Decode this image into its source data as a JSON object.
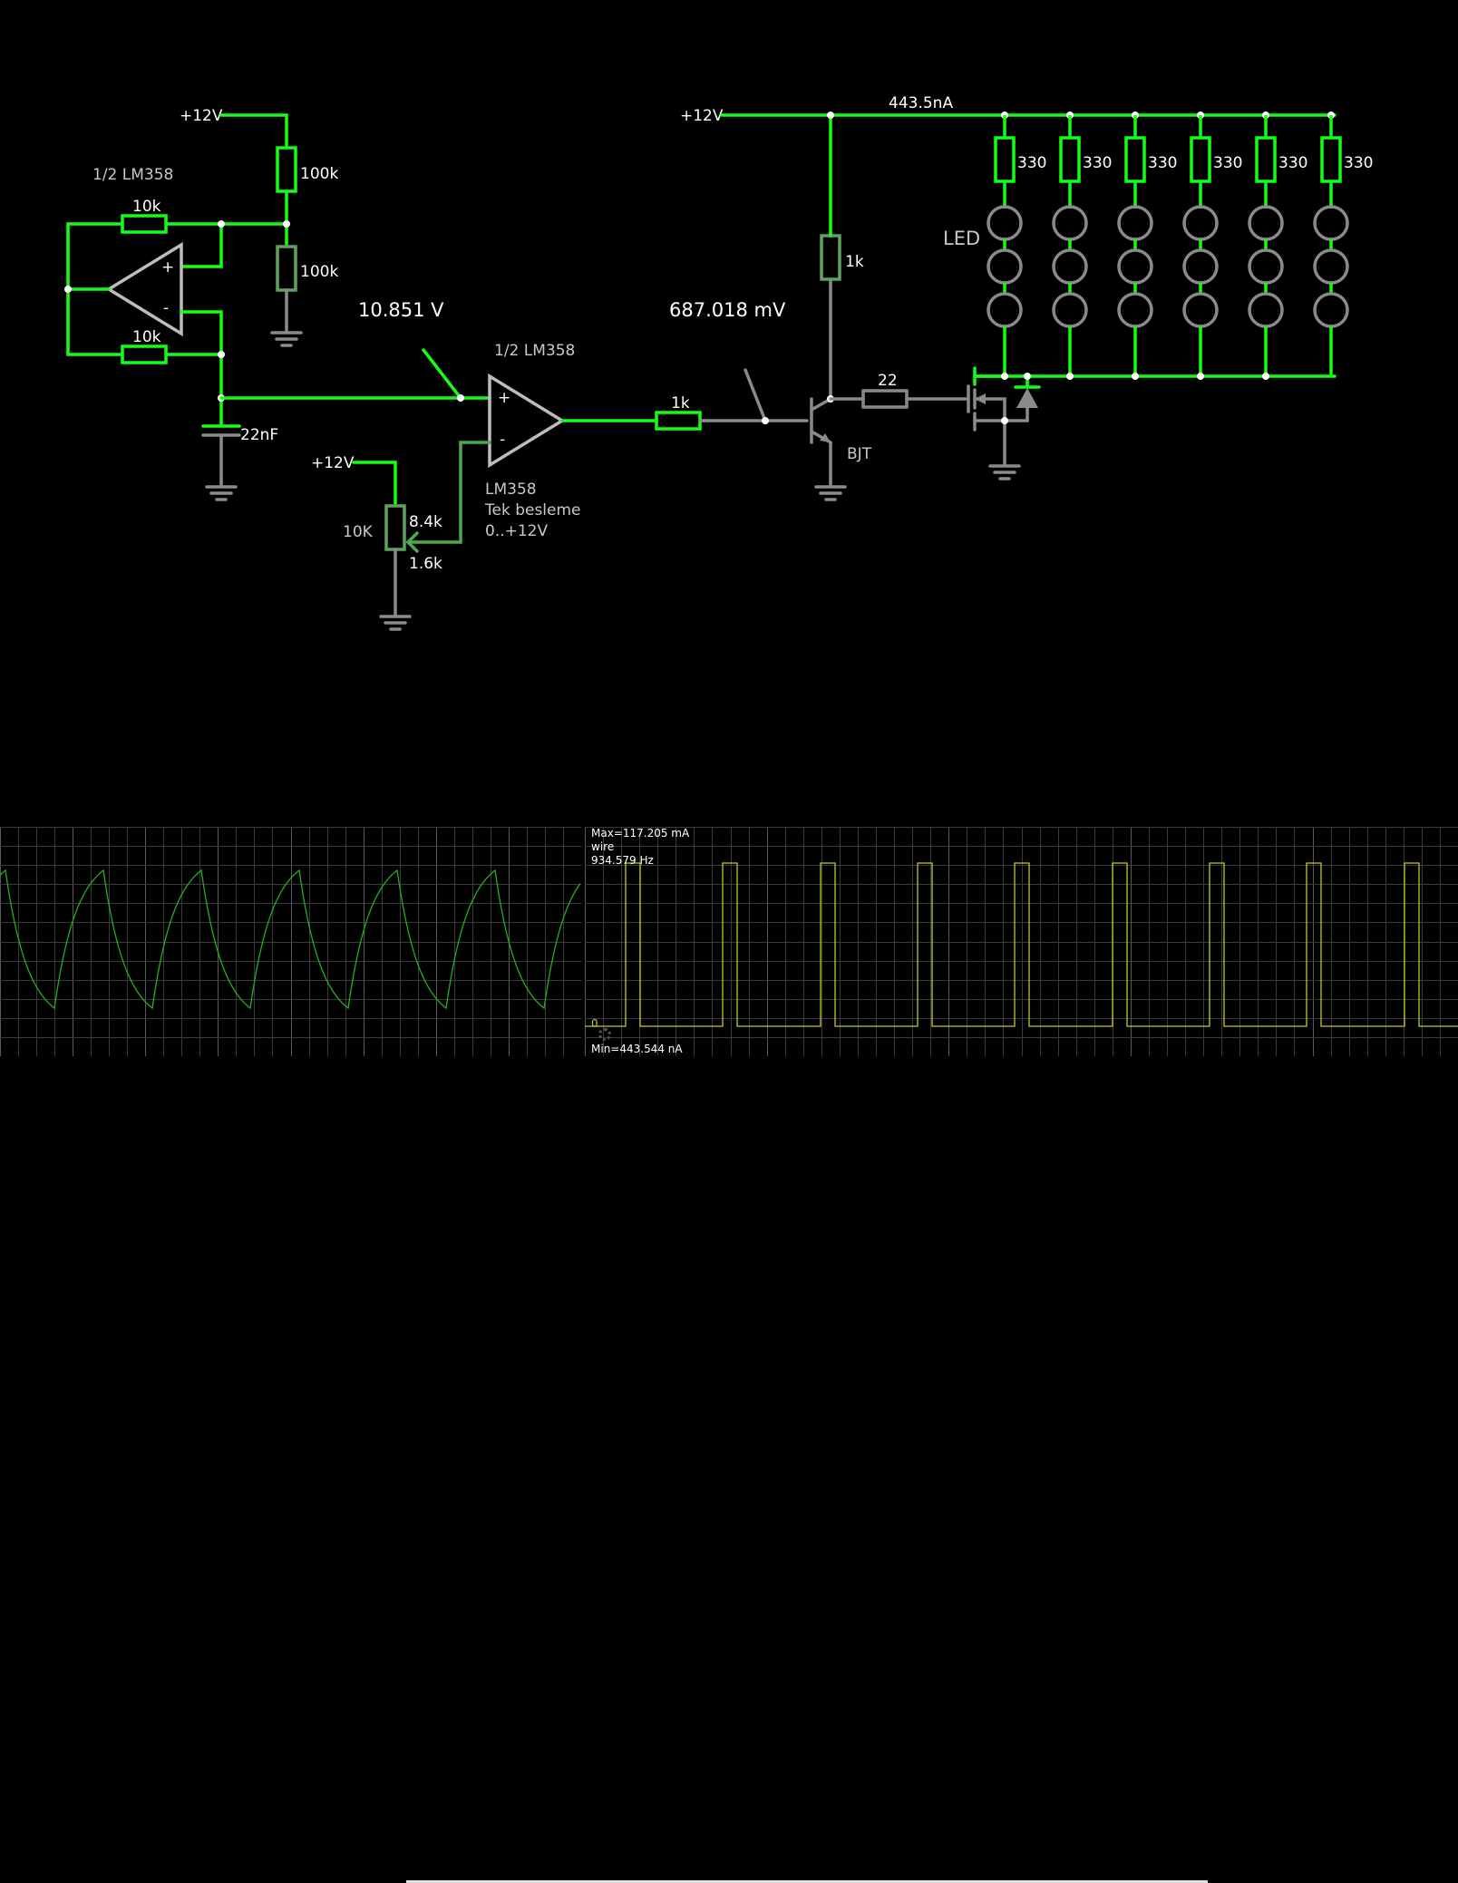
{
  "circuit": {
    "supply_labels": [
      "+12V",
      "+12V",
      "+12V"
    ],
    "oscillator": {
      "opamp_label": "1/2 LM358",
      "r_top": "10k",
      "r_bottom": "10k",
      "divider_top": "100k",
      "divider_bottom": "100k",
      "cap": "22nF",
      "plus": "+",
      "minus": "-"
    },
    "comparator": {
      "opamp_label": "1/2 LM358",
      "plus": "+",
      "minus": "-",
      "note_line1": "LM358",
      "note_line2": "Tek besleme",
      "note_line3": "0..+12V",
      "pot_label": "10K",
      "pot_top": "8.4k",
      "pot_bottom": "1.6k"
    },
    "probe_left_value": "10.851 V",
    "probe_right_value": "687.018 mV",
    "base_resistor": "1k",
    "collector_resistor": "1k",
    "gate_resistor": "22",
    "transistor_label": "BJT",
    "rail_current": "443.5nA",
    "led_label": "LED",
    "led_resistors": [
      "330",
      "330",
      "330",
      "330",
      "330",
      "330"
    ]
  },
  "scope_right": {
    "max_label": "Max=117.205 mA",
    "name_label": "wire",
    "freq_label": "934.579 Hz",
    "zero_label": "0",
    "min_label": "Min=443.544 nA"
  },
  "colors": {
    "wire_active": "#14ff14",
    "wire_inactive": "#8a8a8a",
    "scope_left_trace": "#22b022",
    "scope_right_trace": "#c8c820",
    "scope_grid": "#3a3a3a"
  }
}
